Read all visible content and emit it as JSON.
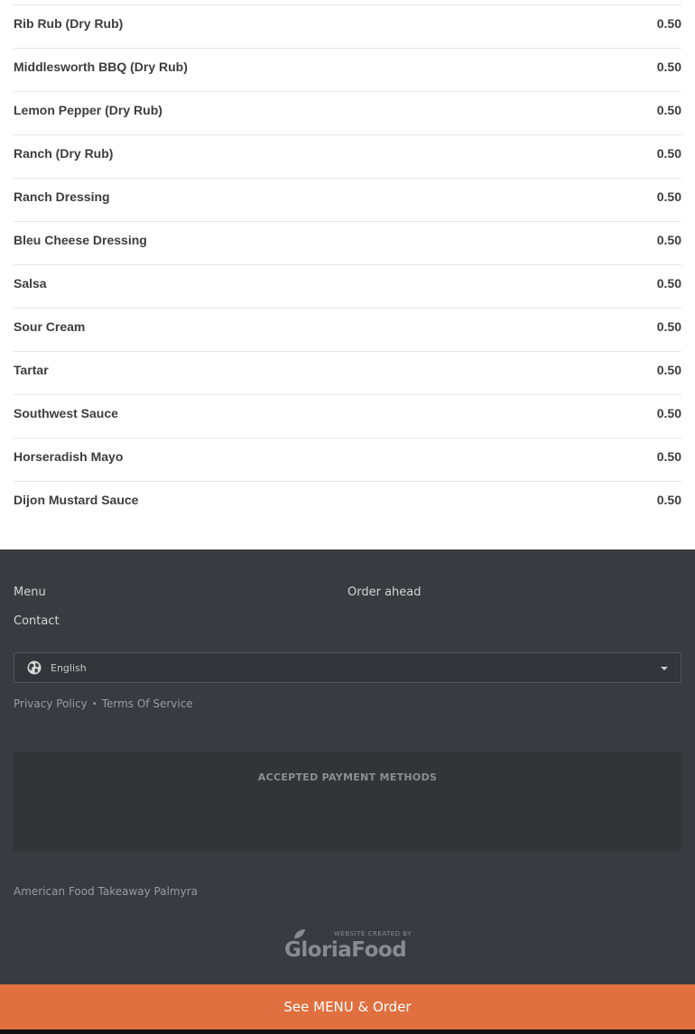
{
  "menu_items": [
    {
      "name": "Rib Rub (Dry Rub)",
      "price": "0.50"
    },
    {
      "name": "Middlesworth BBQ (Dry Rub)",
      "price": "0.50"
    },
    {
      "name": "Lemon Pepper (Dry Rub)",
      "price": "0.50"
    },
    {
      "name": "Ranch (Dry Rub)",
      "price": "0.50"
    },
    {
      "name": "Ranch Dressing",
      "price": "0.50"
    },
    {
      "name": "Bleu Cheese Dressing",
      "price": "0.50"
    },
    {
      "name": "Salsa",
      "price": "0.50"
    },
    {
      "name": "Sour Cream",
      "price": "0.50"
    },
    {
      "name": "Tartar",
      "price": "0.50"
    },
    {
      "name": "Southwest Sauce",
      "price": "0.50"
    },
    {
      "name": "Horseradish Mayo",
      "price": "0.50"
    },
    {
      "name": "Dijon Mustard Sauce",
      "price": "0.50"
    }
  ],
  "footer": {
    "links": {
      "menu": "Menu",
      "order_ahead": "Order ahead",
      "contact": "Contact"
    },
    "language": {
      "icon": "globe-icon",
      "selected": "English"
    },
    "legal": {
      "privacy": "Privacy Policy",
      "separator": "•",
      "terms": "Terms Of Service"
    },
    "payment_title": "ACCEPTED PAYMENT METHODS",
    "restaurant": "American Food Takeaway Palmyra",
    "credit": {
      "small": "WEBSITE CREATED BY",
      "brand": "GloriaFood"
    }
  },
  "cta": {
    "label": "See MENU & Order"
  },
  "colors": {
    "accent": "#e0703f",
    "footer_bg": "#3a3b40",
    "text": "#3d3d3d"
  }
}
